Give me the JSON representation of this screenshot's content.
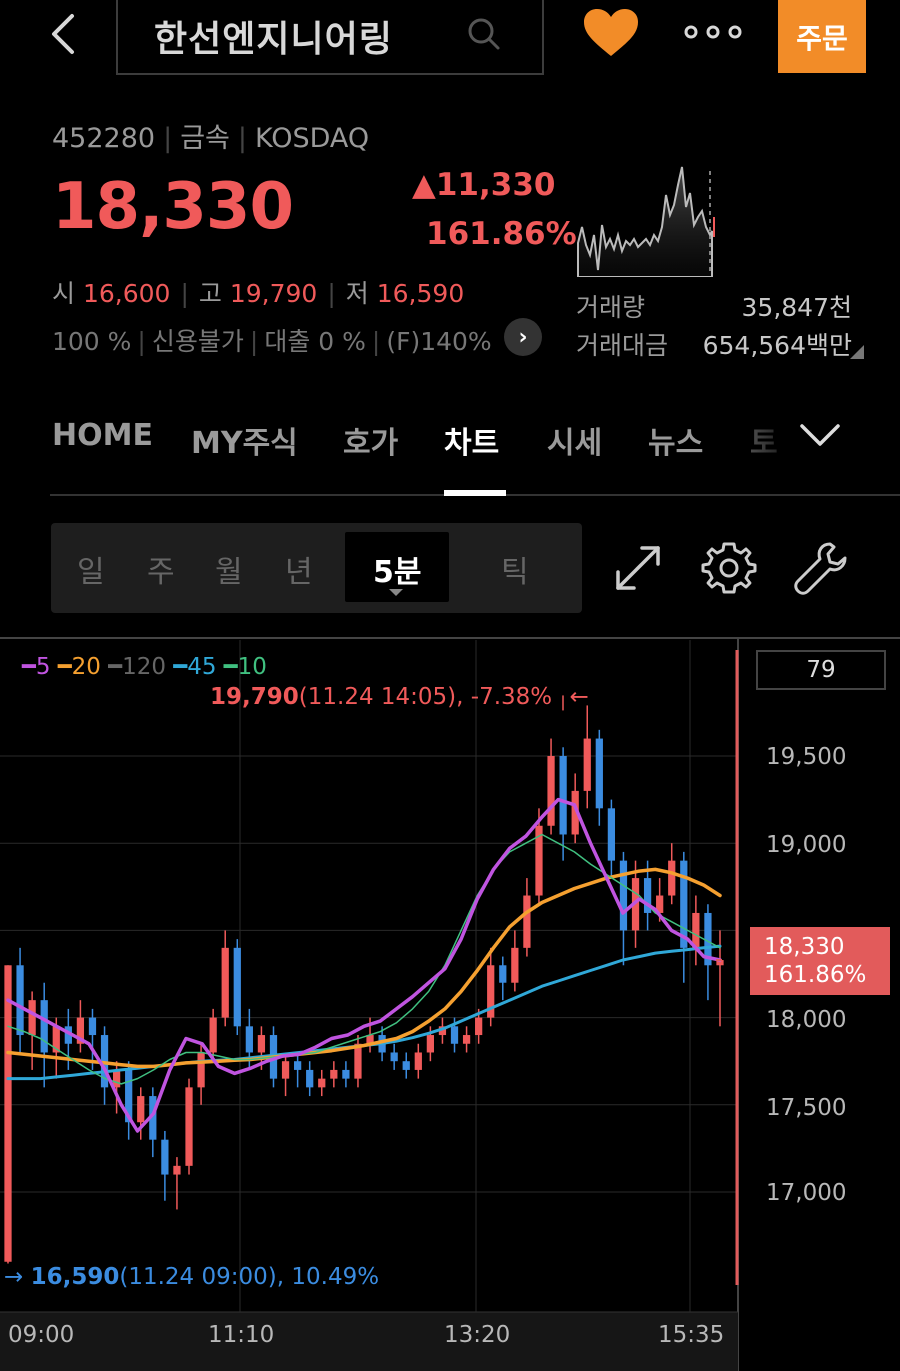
{
  "header": {
    "stock_name": "한선엔지니어링",
    "order_label": "주문"
  },
  "info": {
    "code": "452280",
    "sector": "금속",
    "market": "KOSDAQ",
    "price": "18,330",
    "change": "▲11,330",
    "change_pct": "161.86%",
    "open_label": "시",
    "open": "16,600",
    "high_label": "고",
    "high": "19,790",
    "low_label": "저",
    "low": "16,590",
    "margin": "100 %",
    "credit": "신용불가",
    "loan": "대출 0 %",
    "foreign": "(F)140%",
    "volume_label": "거래량",
    "volume": "35,847천",
    "amount_label": "거래대금",
    "amount": "654,564백만"
  },
  "tabs": [
    "HOME",
    "MY주식",
    "호가",
    "차트",
    "시세",
    "뉴스",
    "토"
  ],
  "period": [
    "일",
    "주",
    "월",
    "년",
    "5분",
    "틱"
  ],
  "colors": {
    "up": "#f05a5a",
    "down": "#3b8ce0",
    "order": "#f28c28",
    "ma5": "#c054e0",
    "ma20": "#f5a030",
    "ma120": "#666666",
    "ma45": "#30a8d8",
    "ma10": "#40c080"
  },
  "chart_data": {
    "type": "candlestick",
    "interval": "5분",
    "top_box": "79",
    "legend": [
      {
        "name": "5",
        "color": "#c054e0"
      },
      {
        "name": "20",
        "color": "#f5a030"
      },
      {
        "name": "120",
        "color": "#666666"
      },
      {
        "name": "45",
        "color": "#30a8d8"
      },
      {
        "name": "10",
        "color": "#40c080"
      }
    ],
    "high_annotation": {
      "value": "19,790",
      "detail": "(11.24 14:05), -7.38%",
      "arrow": "←"
    },
    "low_annotation": {
      "value": "16,590",
      "detail": "(11.24 09:00), 10.49%",
      "arrow": "→"
    },
    "yticks": [
      "19,500",
      "19,000",
      "18,000",
      "17,500",
      "17,000"
    ],
    "xticks": [
      "09:00",
      "11:10",
      "13:20",
      "15:35"
    ],
    "ylim": [
      16500,
      20000
    ],
    "current": {
      "price": "18,330",
      "pct": "161.86%"
    },
    "candles": [
      [
        16600,
        18300,
        18300,
        16590
      ],
      [
        18300,
        17900,
        18400,
        17800
      ],
      [
        17900,
        18100,
        18150,
        17700
      ],
      [
        18100,
        17800,
        18200,
        17600
      ],
      [
        17800,
        17950,
        18000,
        17650
      ],
      [
        17950,
        17850,
        18050,
        17700
      ],
      [
        17850,
        18000,
        18100,
        17800
      ],
      [
        18000,
        17900,
        18050,
        17700
      ],
      [
        17900,
        17600,
        17950,
        17500
      ],
      [
        17600,
        17700,
        17750,
        17450
      ],
      [
        17700,
        17400,
        17750,
        17300
      ],
      [
        17400,
        17550,
        17600,
        17300
      ],
      [
        17550,
        17300,
        17600,
        17200
      ],
      [
        17300,
        17100,
        17350,
        16950
      ],
      [
        17100,
        17150,
        17200,
        16900
      ],
      [
        17150,
        17600,
        17650,
        17100
      ],
      [
        17600,
        17800,
        17850,
        17500
      ],
      [
        17800,
        18000,
        18050,
        17750
      ],
      [
        18000,
        18400,
        18500,
        17950
      ],
      [
        18400,
        17950,
        18450,
        17900
      ],
      [
        17950,
        17800,
        18050,
        17700
      ],
      [
        17800,
        17900,
        17950,
        17700
      ],
      [
        17900,
        17650,
        17950,
        17600
      ],
      [
        17650,
        17750,
        17800,
        17550
      ],
      [
        17750,
        17700,
        17800,
        17600
      ],
      [
        17700,
        17600,
        17750,
        17550
      ],
      [
        17600,
        17650,
        17700,
        17550
      ],
      [
        17650,
        17700,
        17750,
        17600
      ],
      [
        17700,
        17650,
        17750,
        17600
      ],
      [
        17650,
        17850,
        17900,
        17600
      ],
      [
        17850,
        17900,
        18000,
        17800
      ],
      [
        17900,
        17800,
        17950,
        17750
      ],
      [
        17800,
        17750,
        17850,
        17700
      ],
      [
        17750,
        17700,
        17800,
        17650
      ],
      [
        17700,
        17800,
        17850,
        17650
      ],
      [
        17800,
        17900,
        17950,
        17750
      ],
      [
        17900,
        17950,
        18000,
        17850
      ],
      [
        17950,
        17850,
        18000,
        17800
      ],
      [
        17850,
        17900,
        17950,
        17800
      ],
      [
        17900,
        18000,
        18050,
        17850
      ],
      [
        18000,
        18300,
        18400,
        17950
      ],
      [
        18300,
        18200,
        18350,
        18100
      ],
      [
        18200,
        18400,
        18500,
        18150
      ],
      [
        18400,
        18700,
        18800,
        18350
      ],
      [
        18700,
        19100,
        19200,
        18650
      ],
      [
        19100,
        19500,
        19600,
        19050
      ],
      [
        19500,
        19050,
        19550,
        18900
      ],
      [
        19050,
        19300,
        19400,
        19000
      ],
      [
        19300,
        19600,
        19790,
        19200
      ],
      [
        19600,
        19200,
        19650,
        19100
      ],
      [
        19200,
        18900,
        19250,
        18800
      ],
      [
        18900,
        18500,
        18950,
        18300
      ],
      [
        18500,
        18800,
        18900,
        18400
      ],
      [
        18800,
        18600,
        18900,
        18500
      ],
      [
        18600,
        18700,
        18800,
        18550
      ],
      [
        18700,
        18900,
        19000,
        18650
      ],
      [
        18900,
        18400,
        18950,
        18200
      ],
      [
        18400,
        18600,
        18700,
        18300
      ],
      [
        18600,
        18300,
        18650,
        18100
      ],
      [
        18300,
        18330,
        18500,
        17950
      ]
    ],
    "ma5": [
      18100,
      18050,
      18000,
      17950,
      17900,
      17850,
      17700,
      17500,
      17350,
      17450,
      17700,
      17880,
      17850,
      17720,
      17680,
      17710,
      17750,
      17780,
      17790,
      17830,
      17880,
      17900,
      17950,
      17980,
      18050,
      18120,
      18200,
      18280,
      18450,
      18680,
      18850,
      18970,
      19040,
      19150,
      19250,
      19220,
      19000,
      18800,
      18600,
      18680,
      18620,
      18500,
      18450,
      18350,
      18330
    ],
    "ma10": [
      17950,
      17920,
      17880,
      17820,
      17760,
      17700,
      17650,
      17620,
      17650,
      17700,
      17760,
      17800,
      17800,
      17780,
      17760,
      17760,
      17770,
      17780,
      17790,
      17800,
      17830,
      17860,
      17890,
      17920,
      17970,
      18050,
      18150,
      18300,
      18500,
      18700,
      18850,
      18950,
      19000,
      19050,
      19000,
      18950,
      18880,
      18820,
      18760,
      18700,
      18600,
      18550,
      18500,
      18450,
      18400
    ],
    "ma20": [
      17800,
      17790,
      17780,
      17770,
      17760,
      17750,
      17740,
      17730,
      17720,
      17720,
      17730,
      17740,
      17745,
      17750,
      17755,
      17760,
      17770,
      17780,
      17790,
      17800,
      17810,
      17825,
      17840,
      17860,
      17880,
      17920,
      17980,
      18050,
      18150,
      18270,
      18400,
      18520,
      18600,
      18660,
      18700,
      18740,
      18770,
      18800,
      18820,
      18840,
      18850,
      18830,
      18800,
      18760,
      18700
    ],
    "ma45": [
      17650,
      17650,
      17650,
      17660,
      17670,
      17680,
      17690,
      17700,
      17710,
      17720,
      17730,
      17740,
      17750,
      17755,
      17760,
      17770,
      17780,
      17790,
      17800,
      17810,
      17820,
      17830,
      17840,
      17850,
      17865,
      17885,
      17910,
      17940,
      17980,
      18020,
      18060,
      18100,
      18140,
      18180,
      18210,
      18240,
      18270,
      18300,
      18330,
      18350,
      18370,
      18380,
      18390,
      18400,
      18410
    ]
  }
}
